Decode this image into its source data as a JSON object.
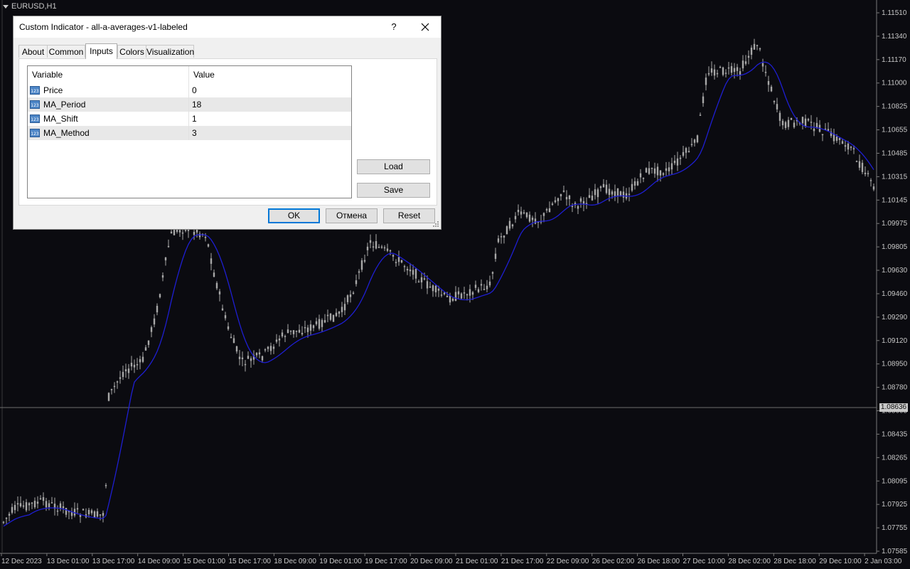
{
  "chart": {
    "symbol_label": "EURUSD,H1",
    "current_price": "1.08636",
    "price_axis": [
      "1.11510",
      "1.11340",
      "1.11170",
      "1.11000",
      "1.10825",
      "1.10655",
      "1.10485",
      "1.10315",
      "1.10145",
      "1.09975",
      "1.09805",
      "1.09630",
      "1.09460",
      "1.09290",
      "1.09120",
      "1.08950",
      "1.08780",
      "1.08605",
      "1.08435",
      "1.08265",
      "1.08095",
      "1.07925",
      "1.07755",
      "1.07585"
    ],
    "time_axis": [
      "12 Dec 2023",
      "13 Dec 01:00",
      "13 Dec 17:00",
      "14 Dec 09:00",
      "15 Dec 01:00",
      "15 Dec 17:00",
      "18 Dec 09:00",
      "19 Dec 01:00",
      "19 Dec 17:00",
      "20 Dec 09:00",
      "21 Dec 01:00",
      "21 Dec 17:00",
      "22 Dec 09:00",
      "26 Dec 02:00",
      "26 Dec 18:00",
      "27 Dec 10:00",
      "28 Dec 02:00",
      "28 Dec 18:00",
      "29 Dec 10:00",
      "2 Jan 03:00"
    ],
    "colors": {
      "background": "#0b0b10",
      "candle": "#a8a8a8",
      "ma_line": "#1e1ed2",
      "grid": "#555555"
    }
  },
  "dialog": {
    "title": "Custom Indicator - all-a-averages-v1-labeled",
    "help": "?",
    "tabs": [
      {
        "label": "About"
      },
      {
        "label": "Common"
      },
      {
        "label": "Inputs",
        "active": true
      },
      {
        "label": "Colors"
      },
      {
        "label": "Visualization"
      }
    ],
    "inputs": {
      "headers": {
        "variable": "Variable",
        "value": "Value"
      },
      "rows": [
        {
          "name": "Price",
          "value": "0",
          "icon": "number-123-icon"
        },
        {
          "name": "MA_Period",
          "value": "18",
          "icon": "number-123-icon"
        },
        {
          "name": "MA_Shift",
          "value": "1",
          "icon": "number-123-icon"
        },
        {
          "name": "MA_Method",
          "value": "3",
          "icon": "number-123-icon"
        }
      ]
    },
    "buttons": {
      "load": "Load",
      "save": "Save",
      "ok": "OK",
      "cancel": "Отмена",
      "reset": "Reset"
    }
  }
}
